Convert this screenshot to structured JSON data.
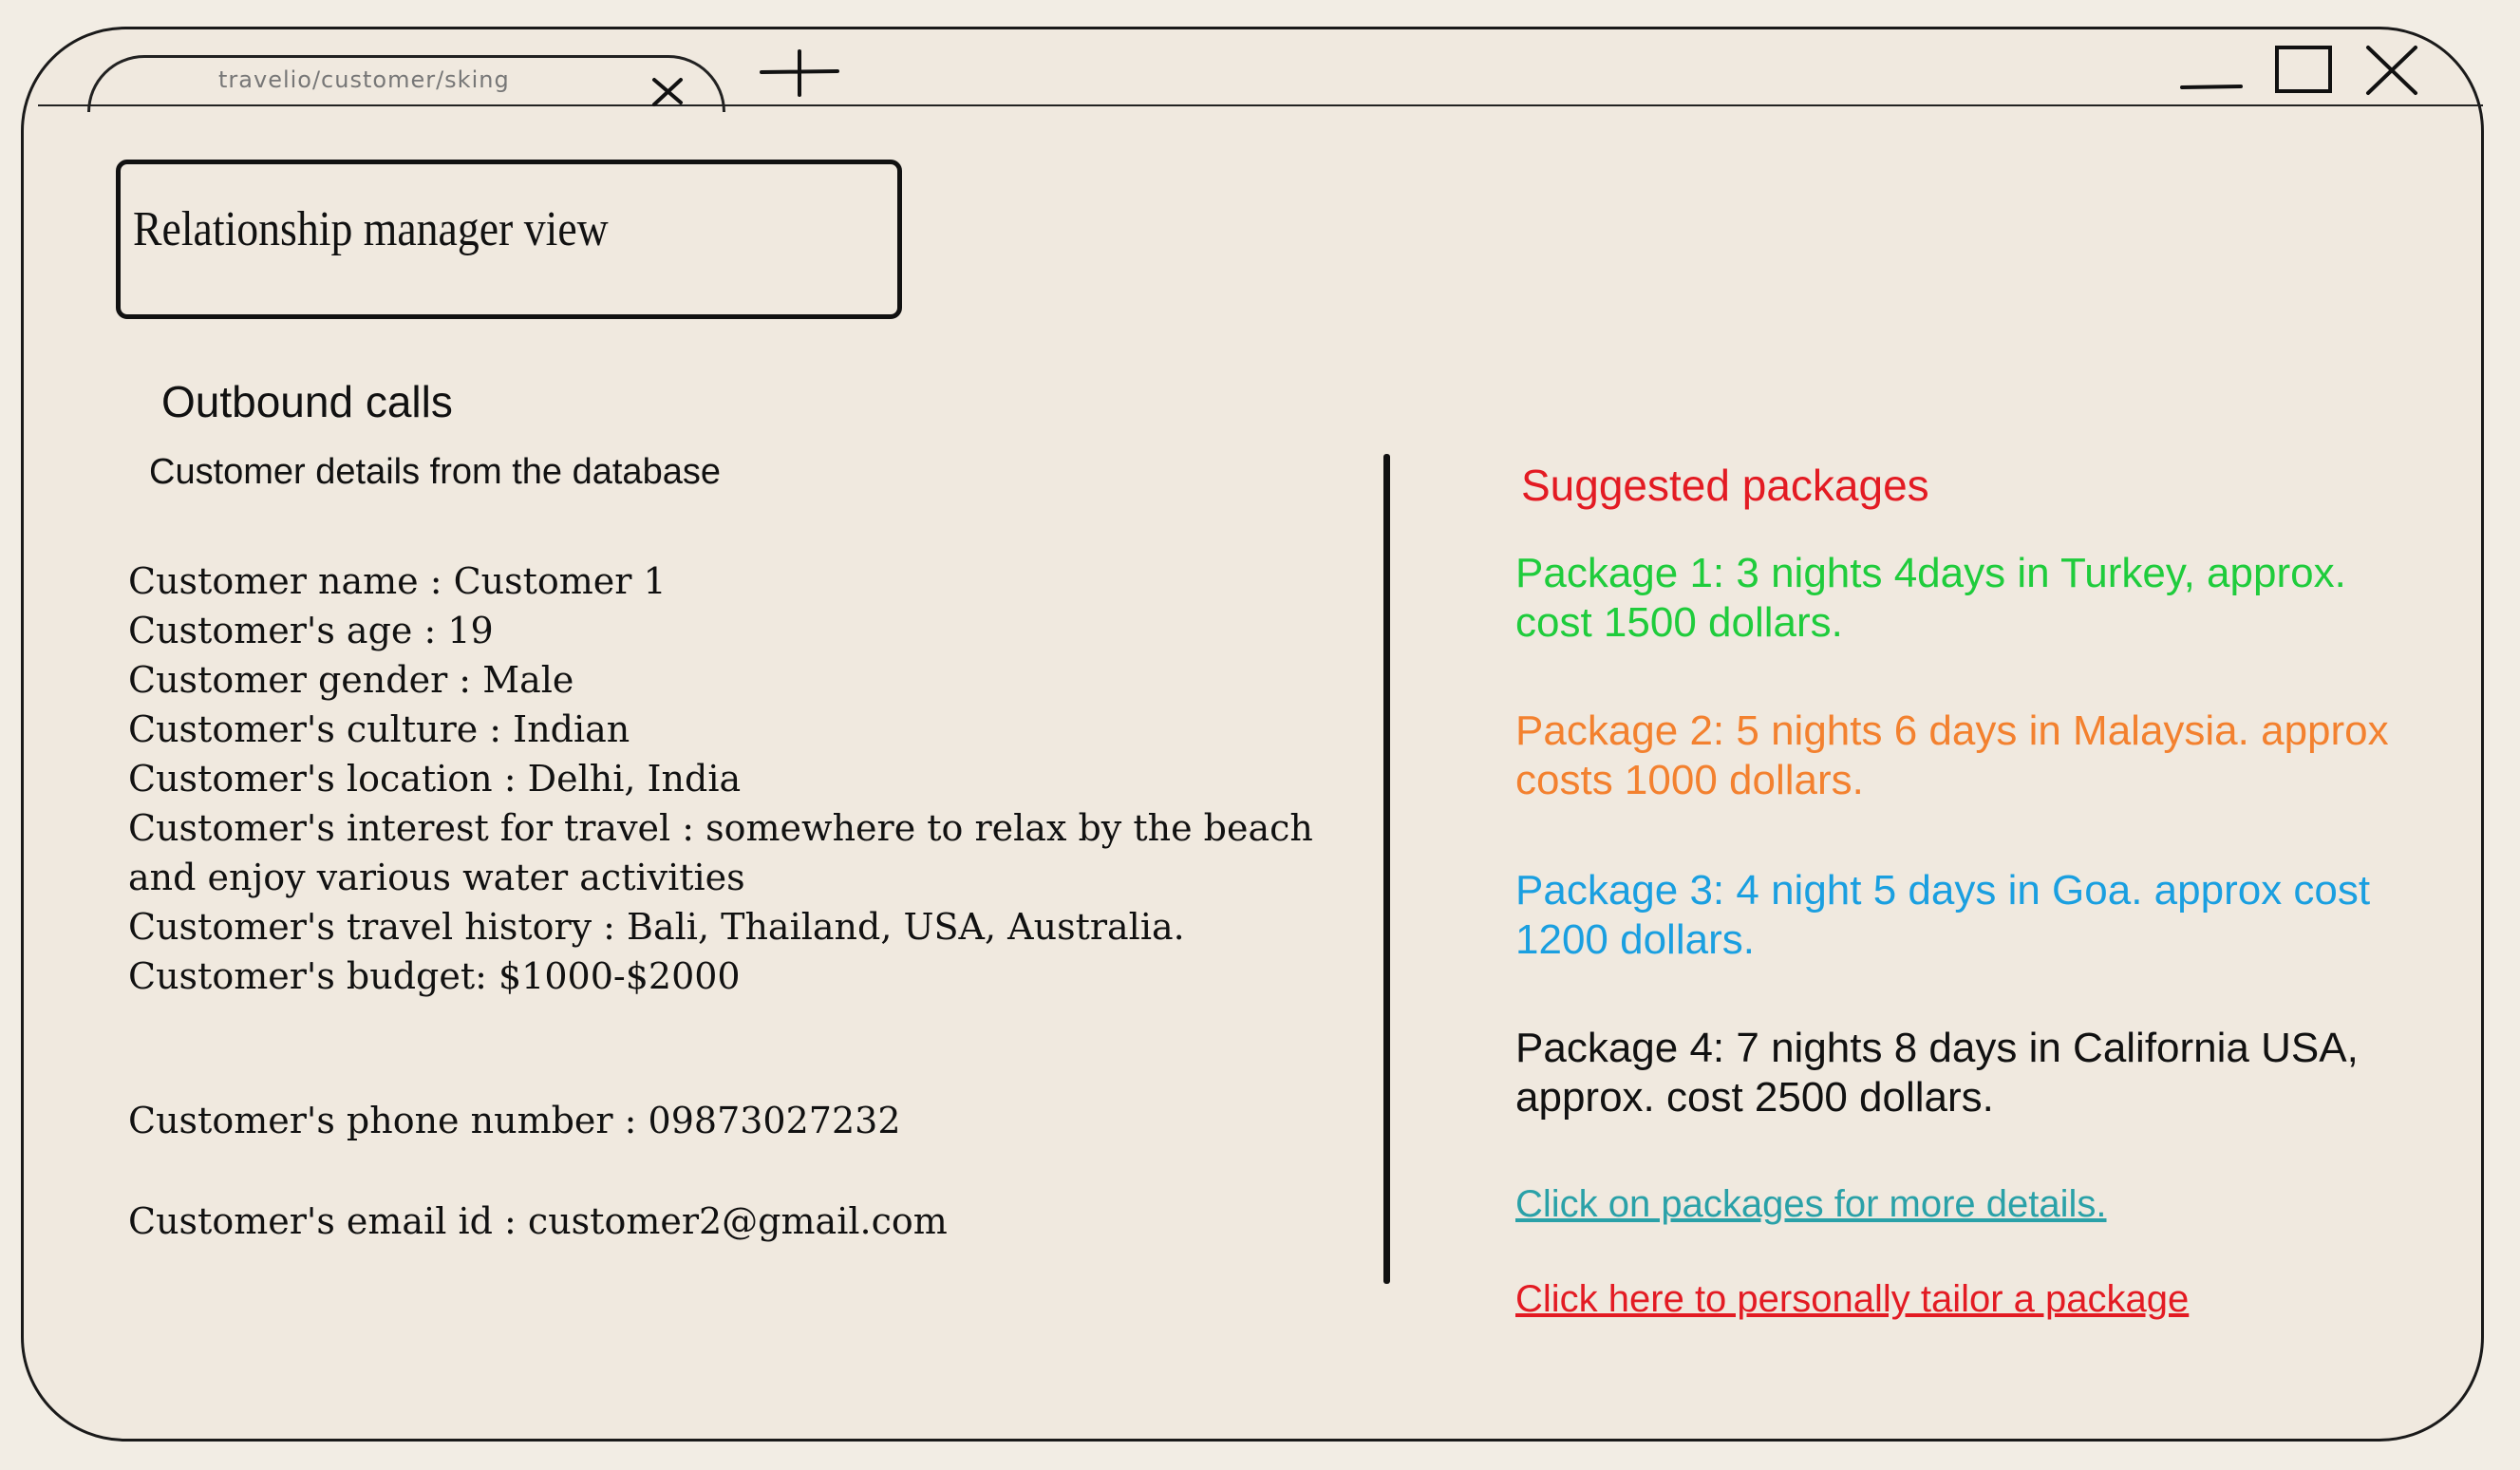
{
  "browser": {
    "tab_title": "travelio/customer/sking",
    "icons": {
      "tab_close": "close-icon",
      "new_tab": "plus-icon",
      "minimize": "minimize-icon",
      "maximize": "maximize-icon",
      "close": "close-icon"
    }
  },
  "header": {
    "view_title": "Relationship manager view"
  },
  "left": {
    "section_title": "Outbound calls",
    "subtitle": "Customer details from the database",
    "details": [
      "Customer name : Customer 1",
      "Customer's age : 19",
      "Customer gender : Male",
      "Customer's culture : Indian",
      "Customer's location : Delhi, India",
      "Customer's interest for travel : somewhere to relax by the beach and enjoy various water activities",
      "Customer's travel history : Bali, Thailand, USA, Australia.",
      "Customer's budget: $1000-$2000"
    ],
    "phone": "Customer's phone number : 09873027232",
    "email": "Customer's email id : customer2@gmail.com"
  },
  "right": {
    "heading": "Suggested packages",
    "packages": [
      {
        "text": "Package 1: 3 nights 4days in Turkey, approx. cost 1500 dollars.",
        "color": "#1fcc3c"
      },
      {
        "text": "Package 2: 5 nights 6 days in Malaysia. approx costs 1000 dollars.",
        "color": "#f3812f"
      },
      {
        "text": "Package 3: 4 night 5 days in Goa. approx cost 1200 dollars.",
        "color": "#1a9fe0"
      },
      {
        "text": "Package 4: 7 nights 8 days in California USA, approx. cost 2500 dollars.",
        "color": "#111111"
      }
    ],
    "details_link": "Click on packages for more details.",
    "tailor_link": "Click here to personally tailor a package"
  },
  "colors": {
    "heading_red": "#e31b23",
    "link_teal": "#2aa1a8",
    "background": "#f0e9df"
  }
}
